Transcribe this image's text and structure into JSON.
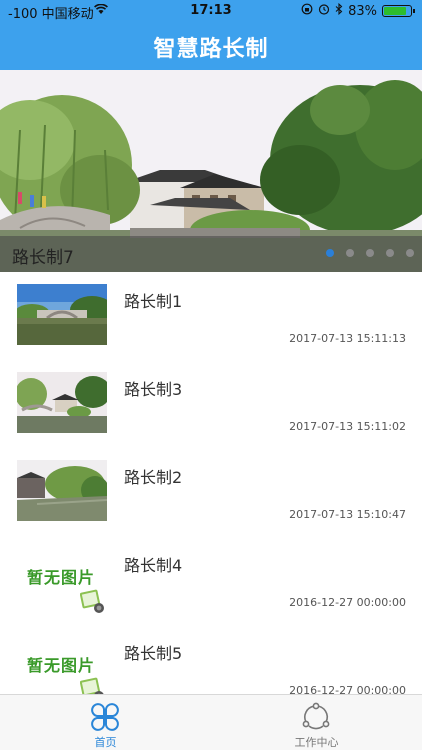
{
  "status_bar": {
    "carrier": "-100 中国移动",
    "time": "17:13",
    "battery": "83%",
    "battery_level": 0.83
  },
  "header": {
    "title": "智慧路长制"
  },
  "banner": {
    "caption": "路长制7",
    "page_count": 5,
    "active_page": 1
  },
  "news": [
    {
      "title": "路长制1",
      "time": "2017-07-13 15:11:13",
      "has_image": true
    },
    {
      "title": "路长制3",
      "time": "2017-07-13 15:11:02",
      "has_image": true
    },
    {
      "title": "路长制2",
      "time": "2017-07-13 15:10:47",
      "has_image": true
    },
    {
      "title": "路长制4",
      "time": "2016-12-27 00:00:00",
      "has_image": false,
      "placeholder": "暂无图片"
    },
    {
      "title": "路长制5",
      "time": "2016-12-27 00:00:00",
      "has_image": false,
      "placeholder": "暂无图片"
    }
  ],
  "tabs": [
    {
      "label": "首页",
      "icon": "clover-icon",
      "active": true
    },
    {
      "label": "工作中心",
      "icon": "share-nodes-icon",
      "active": false
    }
  ],
  "colors": {
    "primary": "#3da1ed",
    "tab_active": "#2a86d8",
    "placeholder_green": "#3a9a2a"
  }
}
